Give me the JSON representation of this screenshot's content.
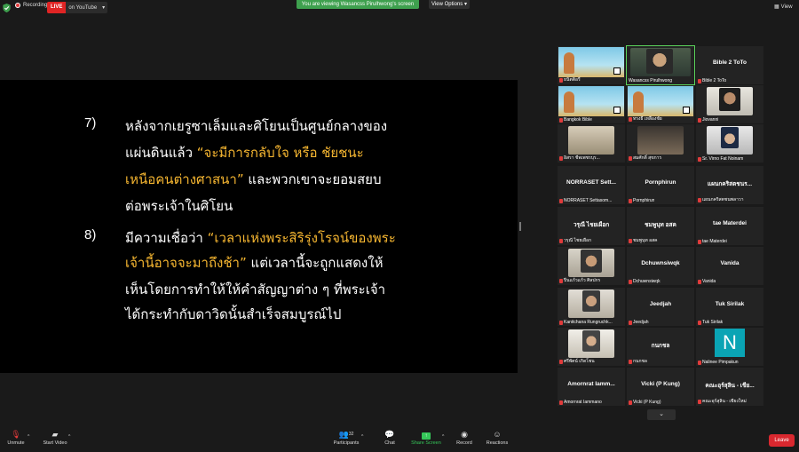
{
  "topbar": {
    "recording": "Recording",
    "live_badge": "LIVE",
    "live_target": "on YouTube",
    "viewing_banner": "You are viewing Wasancss Pirulhwong's screen",
    "view_options": "View Options",
    "view_button": "View"
  },
  "slide": {
    "n7": "7)",
    "n8": "8)",
    "l1": "หลังจากเยรูซาเล็มและศิโยนเป็นศูนย์กลางของ",
    "l2a": "แผ่นดินแล้ว ",
    "l2b": "“จะมีการกลับใจ หรือ ชัยชนะ",
    "l3a": "เหนือคนต่างศาสนา”",
    "l3b": " และพวกเขาจะยอมสยบ",
    "l4": "ต่อพระเจ้าในศิโยน",
    "l5a": "มีความเชื่อว่า ",
    "l5b": "“เวลาแห่งพระสิริรุ่งโรจน์ของพระ",
    "l6a": "เจ้านี้อาจจะมาถึงช้า”",
    "l6b": " แต่เวลานี้จะถูกแสดงให้",
    "l7": "เห็นโดยการทำให้ให้คำสัญญาต่าง ๆ ที่พระเจ้า",
    "l8": "ได้กระทำกับดาวิดนั้นสำเร็จสมบูรณ์ไป"
  },
  "participants": [
    {
      "label": "ธนิตติอรี่",
      "center": ""
    },
    {
      "label": "Wasancss Pirulhwong",
      "center": ""
    },
    {
      "label": "Bible 2 ToTo",
      "center": "Bible 2 ToTo"
    },
    {
      "label": "Bangkok Bible",
      "center": ""
    },
    {
      "label": "ทรงธี เหลืองชัย",
      "center": ""
    },
    {
      "label": "Jiovanni",
      "center": ""
    },
    {
      "label": "อิสรา ชีพเพชรบุร...",
      "center": ""
    },
    {
      "label": "สมศักดิ์ สุขการ",
      "center": ""
    },
    {
      "label": "Sr. Virno Fat Noinam",
      "center": ""
    },
    {
      "label": "NORRASET Settasom...",
      "center": "NORRASET Sett..."
    },
    {
      "label": "Pornphirun",
      "center": "Pornphirun"
    },
    {
      "label": "แผนกคริสตชนพลาวา",
      "center": "แผนกคริสตชนร..."
    },
    {
      "label": "วรุณี ไชยเผือก",
      "center": "วรุณี ไชยเผือก"
    },
    {
      "label": "ชมพูนุท อสค",
      "center": "ชมพูนุท อสค"
    },
    {
      "label": "tae Materdei",
      "center": "tae Materdei"
    },
    {
      "label": "ปิ่นแก้วแก้ว ศิลปกร",
      "center": ""
    },
    {
      "label": "Dchuwnsiwqk",
      "center": "Dchuwnsiwqk"
    },
    {
      "label": "Vanida",
      "center": "Vanida"
    },
    {
      "label": "Kanitchana Rungruchk...",
      "center": ""
    },
    {
      "label": "Jeedjah",
      "center": "Jeedjah"
    },
    {
      "label": "Tuk Sirilak",
      "center": "Tuk Sirilak"
    },
    {
      "label": "ศรีพัตน์ เกิดโชน",
      "center": ""
    },
    {
      "label": "กนกชล",
      "center": "กนกชล"
    },
    {
      "label": "Nalinee Pimpakun",
      "center": "N"
    },
    {
      "label": "Amornrat Iammano",
      "center": "Amornrat Iamm..."
    },
    {
      "label": "Vicki (P Kung)",
      "center": "Vicki (P Kung)"
    },
    {
      "label": "คณะอุร์สุลิน - เชียงใหม่",
      "center": "คณะอุร์สุลิน - เชีย..."
    }
  ],
  "toolbar": {
    "unmute": "Unmute",
    "start_video": "Start Video",
    "participants": "Participants",
    "participants_count": "32",
    "chat": "Chat",
    "share_screen": "Share Screen",
    "record": "Record",
    "reactions": "Reactions",
    "leave": "Leave"
  },
  "colors": {
    "highlight": "#f7b731",
    "live_red": "#e02424",
    "banner_green": "#3ea04e",
    "share_green": "#35c759",
    "leave_red": "#d9282f",
    "muted_red": "#e03b3b"
  }
}
